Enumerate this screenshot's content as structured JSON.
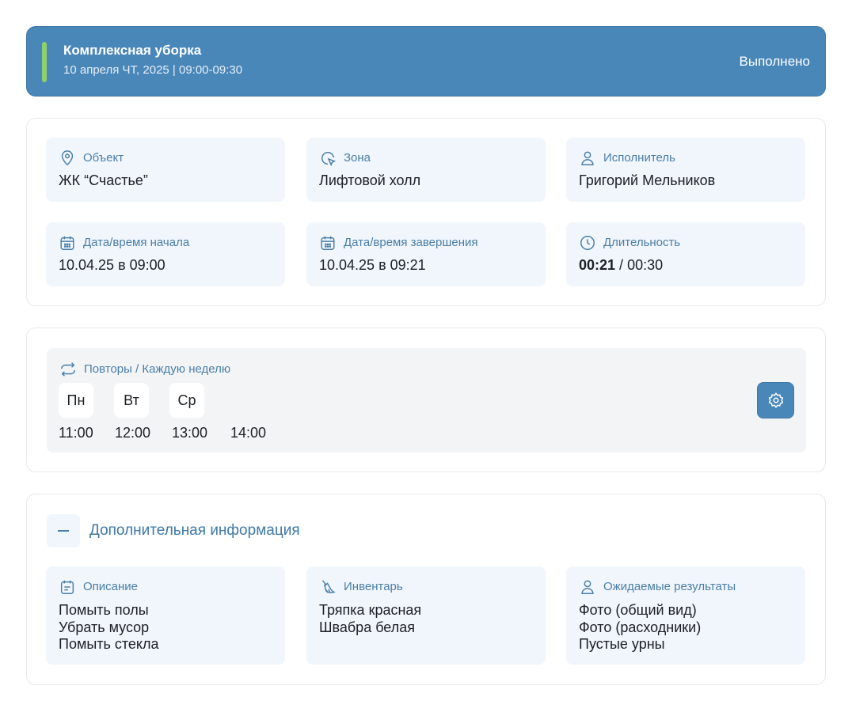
{
  "task": {
    "title": "Комплексная уборка",
    "subtitle": "10 апреля ЧТ, 2025 | 09:00-09:30",
    "status": "Выполнено",
    "colors": {
      "header_bg": "#4a87b9",
      "indicator": "#8fd06e"
    }
  },
  "details": {
    "object": {
      "label": "Объект",
      "value": "ЖК “Счастье”",
      "icon": "location-pin-icon"
    },
    "zone": {
      "label": "Зона",
      "value": "Лифтовой холл",
      "icon": "zone-icon"
    },
    "executor": {
      "label": "Исполнитель",
      "value": "Григорий Мельников",
      "icon": "user-icon"
    },
    "start": {
      "label": "Дата/время начала",
      "value": "10.04.25 в 09:00",
      "icon": "calendar-icon"
    },
    "end": {
      "label": "Дата/время завершения",
      "value": "10.04.25 в 09:21",
      "icon": "calendar-icon"
    },
    "duration": {
      "label": "Длительность",
      "actual": "00:21",
      "separator": " / ",
      "planned": "00:30",
      "icon": "clock-icon"
    }
  },
  "repeat": {
    "label": "Повторы / Каждую неделю",
    "days": [
      "Пн",
      "Вт",
      "Ср"
    ],
    "times": [
      "11:00",
      "12:00",
      "13:00",
      "14:00"
    ]
  },
  "extra": {
    "title": "Дополнительная информация",
    "description": {
      "label": "Описание",
      "items": [
        "Помыть полы",
        "Убрать мусор",
        "Помыть стекла"
      ]
    },
    "inventory": {
      "label": "Инвентарь",
      "items": [
        "Тряпка красная",
        "Швабра белая"
      ]
    },
    "results": {
      "label": "Ожидаемые результаты",
      "items": [
        "Фото (общий вид)",
        "Фото (расходники)",
        "Пустые урны"
      ]
    }
  }
}
